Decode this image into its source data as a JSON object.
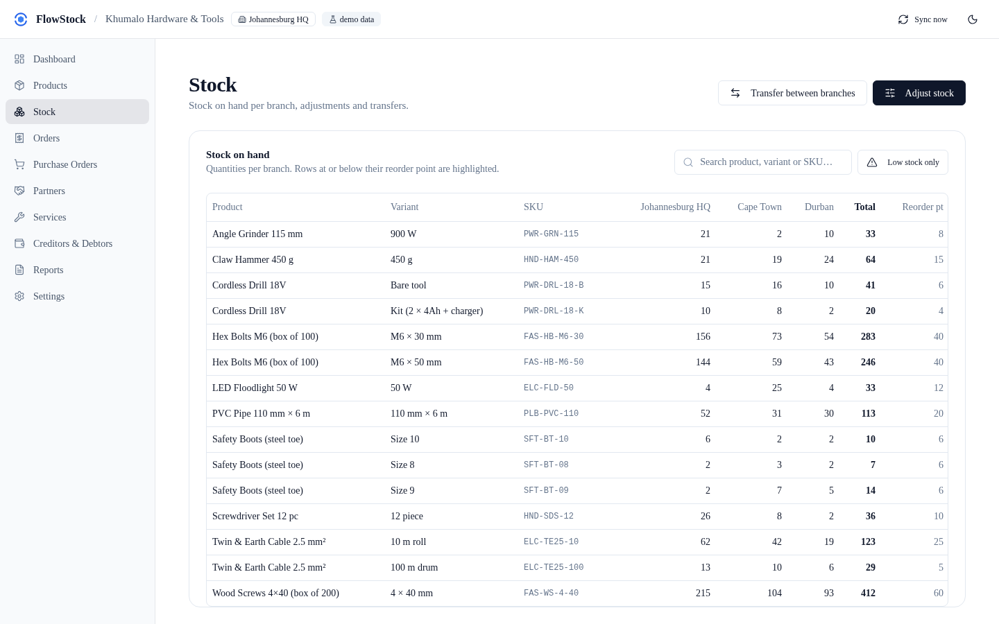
{
  "header": {
    "brand": "FlowStock",
    "separator": "/",
    "company": "Khumalo Hardware & Tools",
    "badges": [
      {
        "label": "Johannesburg HQ",
        "kind": "branch"
      },
      {
        "label": "demo data",
        "kind": "demo"
      }
    ],
    "sync_button": "Sync now"
  },
  "sidebar": {
    "items": [
      {
        "label": "Dashboard",
        "selected": false
      },
      {
        "label": "Products",
        "selected": false
      },
      {
        "label": "Stock",
        "selected": true
      },
      {
        "label": "Orders",
        "selected": false
      },
      {
        "label": "Purchase Orders",
        "selected": false
      },
      {
        "label": "Partners",
        "selected": false
      },
      {
        "label": "Services",
        "selected": false
      },
      {
        "label": "Creditors & Debtors",
        "selected": false
      },
      {
        "label": "Reports",
        "selected": false
      },
      {
        "label": "Settings",
        "selected": false
      }
    ]
  },
  "page": {
    "title": "Stock",
    "subtitle": "Stock on hand per branch, adjustments and transfers.",
    "actions": [
      {
        "label": "Transfer between branches",
        "kind": "secondary"
      },
      {
        "label": "Adjust stock",
        "kind": "primary"
      }
    ]
  },
  "card": {
    "title": "Stock on hand",
    "description": "Quantities per branch. Rows at or below their reorder point are highlighted.",
    "search": {
      "placeholder": "Search product, variant or SKU…"
    },
    "filter_button": "Low stock only"
  },
  "table": {
    "columns": [
      {
        "label": "Product",
        "kind": "text"
      },
      {
        "label": "Variant",
        "kind": "text"
      },
      {
        "label": "SKU",
        "kind": "code"
      },
      {
        "label": "Johannesburg HQ",
        "kind": "number"
      },
      {
        "label": "Cape Town",
        "kind": "number"
      },
      {
        "label": "Durban",
        "kind": "number"
      },
      {
        "label": "Total",
        "kind": "total"
      },
      {
        "label": "Reorder pt",
        "kind": "muted"
      }
    ],
    "rows": [
      [
        "Angle Grinder 115 mm",
        "900 W",
        "PWR-GRN-115",
        "21",
        "2",
        "10",
        "33",
        "8"
      ],
      [
        "Claw Hammer 450 g",
        "450 g",
        "HND-HAM-450",
        "21",
        "19",
        "24",
        "64",
        "15"
      ],
      [
        "Cordless Drill 18V",
        "Bare tool",
        "PWR-DRL-18-B",
        "15",
        "16",
        "10",
        "41",
        "6"
      ],
      [
        "Cordless Drill 18V",
        "Kit (2 × 4Ah + charger)",
        "PWR-DRL-18-K",
        "10",
        "8",
        "2",
        "20",
        "4"
      ],
      [
        "Hex Bolts M6 (box of 100)",
        "M6 × 30 mm",
        "FAS-HB-M6-30",
        "156",
        "73",
        "54",
        "283",
        "40"
      ],
      [
        "Hex Bolts M6 (box of 100)",
        "M6 × 50 mm",
        "FAS-HB-M6-50",
        "144",
        "59",
        "43",
        "246",
        "40"
      ],
      [
        "LED Floodlight 50 W",
        "50 W",
        "ELC-FLD-50",
        "4",
        "25",
        "4",
        "33",
        "12"
      ],
      [
        "PVC Pipe 110 mm × 6 m",
        "110 mm × 6 m",
        "PLB-PVC-110",
        "52",
        "31",
        "30",
        "113",
        "20"
      ],
      [
        "Safety Boots (steel toe)",
        "Size 10",
        "SFT-BT-10",
        "6",
        "2",
        "2",
        "10",
        "6"
      ],
      [
        "Safety Boots (steel toe)",
        "Size 8",
        "SFT-BT-08",
        "2",
        "3",
        "2",
        "7",
        "6"
      ],
      [
        "Safety Boots (steel toe)",
        "Size 9",
        "SFT-BT-09",
        "2",
        "7",
        "5",
        "14",
        "6"
      ],
      [
        "Screwdriver Set 12 pc",
        "12 piece",
        "HND-SDS-12",
        "26",
        "8",
        "2",
        "36",
        "10"
      ],
      [
        "Twin & Earth Cable 2.5 mm²",
        "10 m roll",
        "ELC-TE25-10",
        "62",
        "42",
        "19",
        "123",
        "25"
      ],
      [
        "Twin & Earth Cable 2.5 mm²",
        "100 m drum",
        "ELC-TE25-100",
        "13",
        "10",
        "6",
        "29",
        "5"
      ],
      [
        "Wood Screws 4×40 (box of 200)",
        "4 × 40 mm",
        "FAS-WS-4-40",
        "215",
        "104",
        "93",
        "412",
        "60"
      ]
    ]
  }
}
